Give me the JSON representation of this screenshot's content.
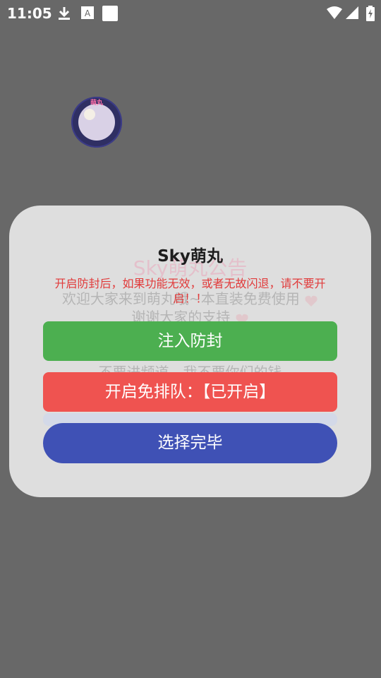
{
  "status_bar": {
    "time": "11:05",
    "icons": [
      "download-icon",
      "keyboard-icon",
      "square-icon",
      "wifi-icon",
      "signal-icon",
      "battery-charging-icon"
    ]
  },
  "logo": {
    "text": "萌丸",
    "icon": "avatar-logo"
  },
  "background_announcement": {
    "title": "Sky萌丸公告",
    "line1": "欢迎大家来到萌丸哦~本直装免费使用",
    "line2": "谢谢大家的支持",
    "line3": "不要进频道，我不要你们的钱"
  },
  "dialog": {
    "title": "Sky萌丸",
    "notice": "开启防封后，如果功能无效，或者无故闪退，请不要开启！！",
    "inject_button": "注入防封",
    "queue_button": "开启免排队：【已开启】",
    "done_button": "选择完毕"
  },
  "colors": {
    "inject": "#4caf50",
    "queue": "#ef5350",
    "done": "#3f51b5",
    "notice": "#e13a3a",
    "overlay": "#686868"
  }
}
